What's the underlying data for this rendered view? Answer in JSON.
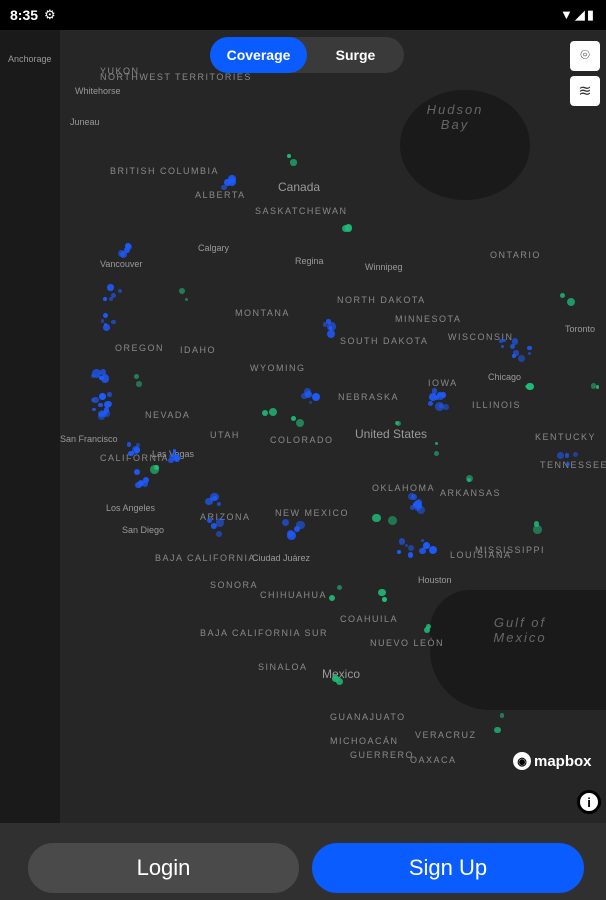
{
  "status_bar": {
    "time": "8:35",
    "settings_icon": "gear-icon",
    "indicators": "wifi signal battery"
  },
  "toggle": {
    "options": [
      "Coverage",
      "Surge"
    ],
    "selected": "Coverage"
  },
  "map_controls": {
    "location_icon": "map-pin-icon",
    "layers_icon": "layers-icon"
  },
  "map": {
    "regions": [
      "YUKON",
      "NORTHWEST TERRITORIES",
      "BRITISH COLUMBIA",
      "ALBERTA",
      "SASKATCHEWAN",
      "MONTANA",
      "NORTH DAKOTA",
      "MINNESOTA",
      "OREGON",
      "IDAHO",
      "WYOMING",
      "SOUTH DAKOTA",
      "NEBRASKA",
      "IOWA",
      "NEVADA",
      "UTAH",
      "COLORADO",
      "CALIFORNIA",
      "ARIZONA",
      "NEW MEXICO",
      "OKLAHOMA",
      "ARKANSAS",
      "MISSISSIPPI",
      "LOUISIANA",
      "TENNESSEE",
      "KENTUCKY",
      "ILLINOIS",
      "WISCONSIN",
      "ONTARIO",
      "BAJA CALIFORNIA",
      "SONORA",
      "CHIHUAHUA",
      "COAHUILA",
      "NUEVO LEÓN",
      "BAJA CALIFORNIA SUR",
      "SINALOA",
      "GUANAJUATO",
      "MICHOACÁN",
      "VERACRUZ",
      "OAXACA",
      "GUERRERO"
    ],
    "cities": [
      "Anchorage",
      "Whitehorse",
      "Juneau",
      "Calgary",
      "Vancouver",
      "Regina",
      "Winnipeg",
      "San Francisco",
      "Las Vegas",
      "Los Angeles",
      "San Diego",
      "Ciudad Juárez",
      "Houston",
      "Chicago",
      "Toronto"
    ],
    "countries": [
      "Canada",
      "United States",
      "Mexico"
    ],
    "water": [
      "Hudson Bay",
      "Gulf of Mexico"
    ],
    "attribution": "mapbox",
    "info_icon": "info-icon"
  },
  "actions": {
    "login": "Login",
    "signup": "Sign Up"
  },
  "colors": {
    "accent": "#0a5cff",
    "coverage_dot": "#1e5bff",
    "surge_dot": "#1fbf7a"
  }
}
